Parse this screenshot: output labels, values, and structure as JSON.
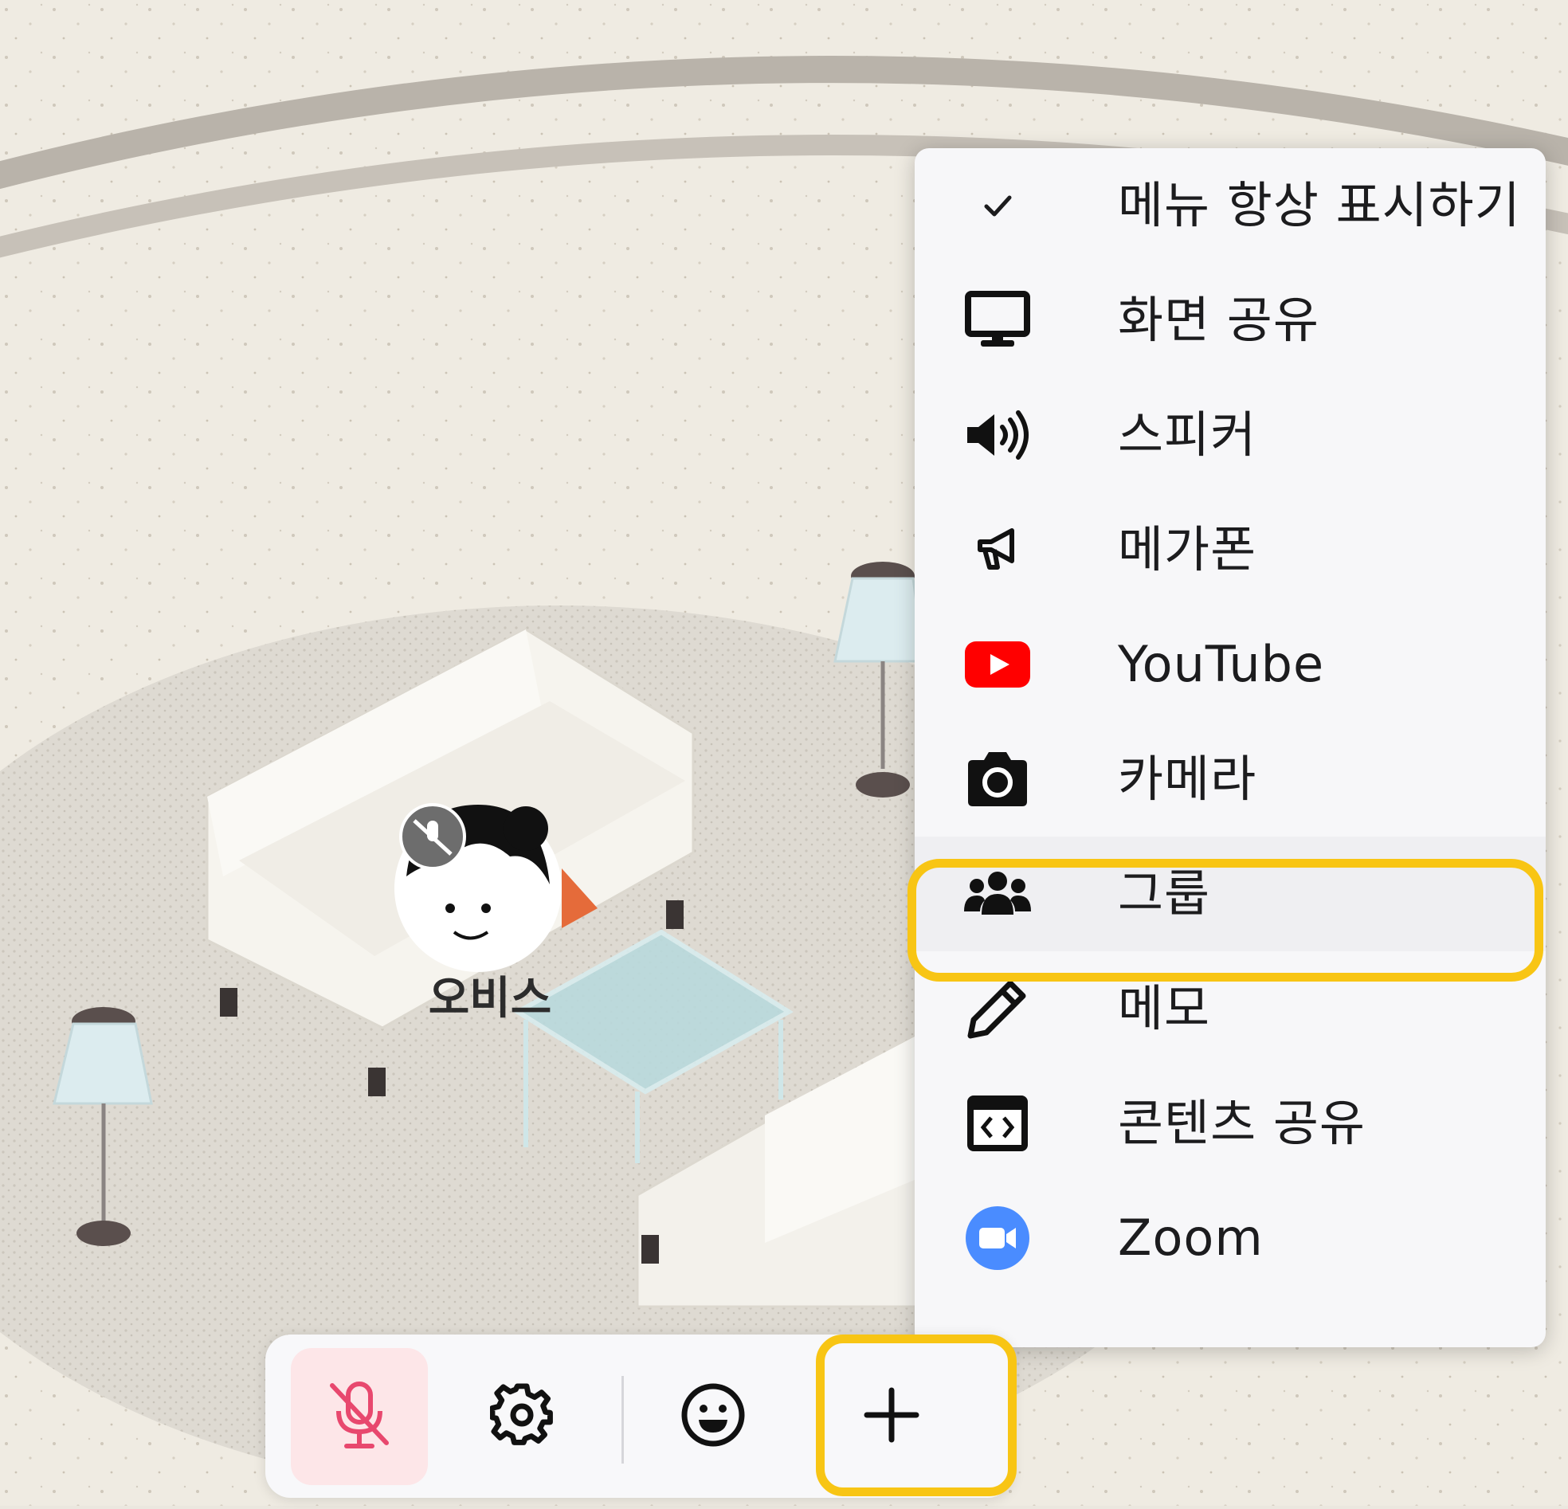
{
  "world": {
    "avatar_name": "오비스"
  },
  "menu": {
    "items": [
      {
        "icon": "check-icon",
        "label": "메뉴 항상 표시하기"
      },
      {
        "icon": "monitor-icon",
        "label": "화면 공유"
      },
      {
        "icon": "speaker-icon",
        "label": "스피커"
      },
      {
        "icon": "megaphone-icon",
        "label": "메가폰"
      },
      {
        "icon": "youtube-icon",
        "label": "YouTube"
      },
      {
        "icon": "camera-icon",
        "label": "카메라"
      },
      {
        "icon": "group-icon",
        "label": "그룹",
        "highlighted": true
      },
      {
        "icon": "pencil-icon",
        "label": "메모"
      },
      {
        "icon": "embed-code-icon",
        "label": "콘텐츠 공유"
      },
      {
        "icon": "zoom-icon",
        "label": "Zoom"
      }
    ]
  },
  "toolbar": {
    "buttons": [
      {
        "icon": "mic-muted-icon",
        "state": "muted"
      },
      {
        "icon": "gear-icon"
      },
      {
        "icon": "smiley-icon"
      },
      {
        "icon": "plus-icon",
        "highlighted": true
      }
    ]
  },
  "colors": {
    "highlight": "#f8c514",
    "youtube_red": "#ff0000",
    "zoom_blue": "#4a8cff",
    "mic_muted": "#e8486e",
    "mic_muted_bg": "#fde6e8"
  }
}
